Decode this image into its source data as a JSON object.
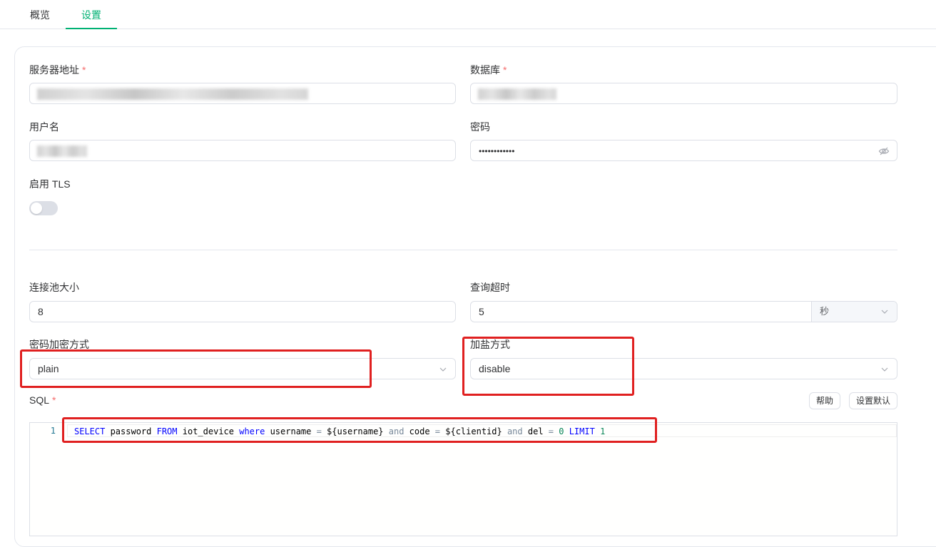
{
  "tabs": [
    {
      "label": "概览",
      "active": false
    },
    {
      "label": "设置",
      "active": true
    }
  ],
  "form": {
    "server": {
      "label": "服务器地址",
      "required": "*"
    },
    "database": {
      "label": "数据库",
      "required": "*"
    },
    "username": {
      "label": "用户名"
    },
    "password": {
      "label": "密码",
      "value": "••••••••••••"
    },
    "tls": {
      "label": "启用 TLS",
      "enabled": false
    },
    "pool_size": {
      "label": "连接池大小",
      "value": "8"
    },
    "query_timeout": {
      "label": "查询超时",
      "value": "5",
      "unit": "秒"
    },
    "password_hash": {
      "label": "密码加密方式",
      "value": "plain"
    },
    "salt": {
      "label": "加盐方式",
      "value": "disable"
    },
    "sql": {
      "label": "SQL",
      "required": "*",
      "help_button": "帮助",
      "reset_button": "设置默认"
    }
  },
  "editor": {
    "line_number": "1",
    "tokens": [
      {
        "t": "SELECT",
        "c": "kw"
      },
      {
        "t": " password ",
        "c": ""
      },
      {
        "t": "FROM",
        "c": "kw"
      },
      {
        "t": " iot_device ",
        "c": ""
      },
      {
        "t": "where",
        "c": "kw"
      },
      {
        "t": " username ",
        "c": ""
      },
      {
        "t": "=",
        "c": "op"
      },
      {
        "t": " ${username} ",
        "c": ""
      },
      {
        "t": "and",
        "c": "op"
      },
      {
        "t": " code ",
        "c": ""
      },
      {
        "t": "=",
        "c": "op"
      },
      {
        "t": " ${clientid} ",
        "c": ""
      },
      {
        "t": "and",
        "c": "op"
      },
      {
        "t": " del ",
        "c": ""
      },
      {
        "t": "=",
        "c": "op"
      },
      {
        "t": " ",
        "c": ""
      },
      {
        "t": "0",
        "c": "num"
      },
      {
        "t": " ",
        "c": ""
      },
      {
        "t": "LIMIT",
        "c": "kw"
      },
      {
        "t": " ",
        "c": ""
      },
      {
        "t": "1",
        "c": "num"
      }
    ]
  },
  "colors": {
    "accent": "#00b173",
    "required": "#f56c6c",
    "highlight_box": "#e02020"
  },
  "icons": {
    "password_toggle": "eye-off-icon",
    "select_arrow": "chevron-down-icon"
  }
}
